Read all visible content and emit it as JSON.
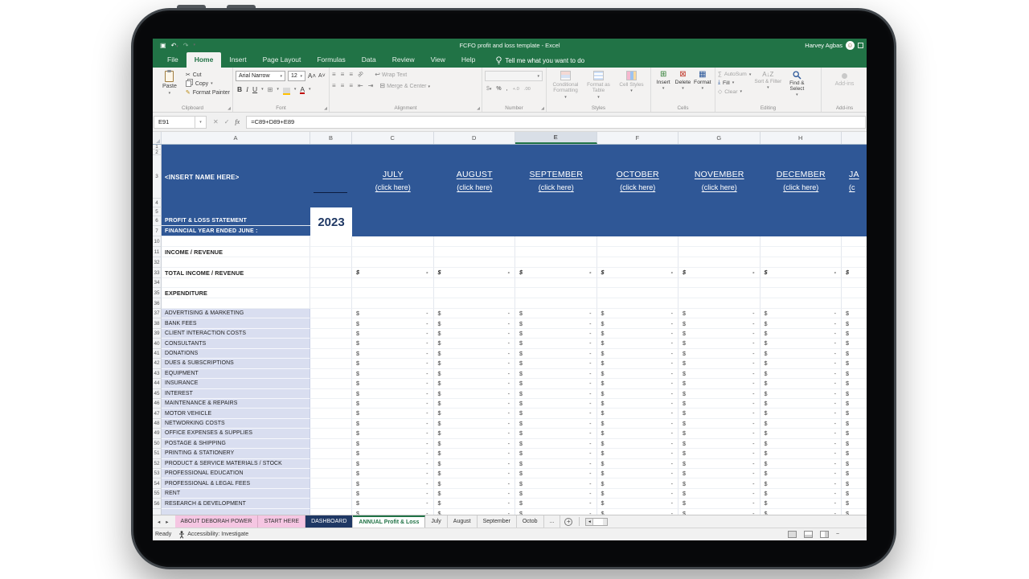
{
  "titlebar": {
    "title": "FCFO profit and loss template  -  Excel",
    "user": "Harvey Agbas"
  },
  "ribbon_tabs": [
    {
      "label": "File"
    },
    {
      "label": "Home"
    },
    {
      "label": "Insert"
    },
    {
      "label": "Page Layout"
    },
    {
      "label": "Formulas"
    },
    {
      "label": "Data"
    },
    {
      "label": "Review"
    },
    {
      "label": "View"
    },
    {
      "label": "Help"
    }
  ],
  "active_tab": "Home",
  "tell_me": "Tell me what you want to do",
  "ribbon": {
    "clipboard": {
      "label": "Clipboard",
      "paste": "Paste",
      "cut": "Cut",
      "copy": "Copy",
      "format_painter": "Format Painter"
    },
    "font": {
      "label": "Font",
      "family": "Arial Narrow",
      "size": "12"
    },
    "alignment": {
      "label": "Alignment",
      "wrap_text": "Wrap Text",
      "merge_center": "Merge & Center"
    },
    "number": {
      "label": "Number"
    },
    "styles": {
      "label": "Styles",
      "conditional": "Conditional Formatting",
      "format_as_table": "Format as Table",
      "cell_styles": "Cell Styles"
    },
    "cells": {
      "label": "Cells",
      "insert": "Insert",
      "delete": "Delete",
      "format": "Format"
    },
    "editing": {
      "label": "Editing",
      "autosum": "AutoSum",
      "fill": "Fill",
      "clear": "Clear",
      "sort_filter": "Sort & Filter",
      "find_select": "Find & Select"
    },
    "addins": {
      "label": "Add-ins",
      "button": "Add-ins"
    }
  },
  "formula_bar": {
    "cell_ref": "E91",
    "formula": "=C89+D89+E89",
    "fx": "fx"
  },
  "grid": {
    "columns": [
      "A",
      "B",
      "C",
      "D",
      "E",
      "F",
      "G",
      "H"
    ],
    "selected_column": "E",
    "row_numbers": [
      "1",
      "2",
      "3",
      "4",
      "5",
      "6",
      "7",
      "10",
      "11",
      "32",
      "33",
      "34",
      "35",
      "36",
      "37",
      "38",
      "39",
      "40",
      "41",
      "42",
      "43",
      "44",
      "45",
      "46",
      "47",
      "48",
      "49",
      "50",
      "51",
      "52",
      "53",
      "54",
      "55",
      "56"
    ],
    "insert_name": "<INSERT NAME HERE>",
    "months": [
      {
        "name": "JULY",
        "link": "(click here)"
      },
      {
        "name": "AUGUST",
        "link": "(click here)"
      },
      {
        "name": "SEPTEMBER",
        "link": "(click here)"
      },
      {
        "name": "OCTOBER",
        "link": "(click here)"
      },
      {
        "name": "NOVEMBER",
        "link": "(click here)"
      },
      {
        "name": "DECEMBER",
        "link": "(click here)"
      },
      {
        "name": "JA",
        "link": "(c"
      }
    ],
    "statement_title": "PROFIT & LOSS STATEMENT",
    "fy_label": "FINANCIAL YEAR ENDED JUNE :",
    "year": "2023",
    "income_header": "INCOME / REVENUE",
    "total_income_label": "TOTAL INCOME / REVENUE",
    "expenditure_label": "EXPENDITURE",
    "expenses": [
      "ADVERTISING & MARKETING",
      "BANK FEES",
      "CLIENT INTERACTION COSTS",
      "CONSULTANTS",
      "DONATIONS",
      "DUES & SUBSCRIPTIONS",
      "EQUIPMENT",
      "INSURANCE",
      "INTEREST",
      "MAINTENANCE & REPAIRS",
      "MOTOR VEHICLE",
      "NETWORKING COSTS",
      "OFFICE EXPENSES & SUPPLIES",
      "POSTAGE & SHIPPING",
      "PRINTING & STATIONERY",
      "PRODUCT & SERVICE MATERIALS / STOCK",
      "PROFESSIONAL EDUCATION",
      "PROFESSIONAL & LEGAL FEES",
      "RENT",
      "RESEARCH & DEVELOPMENT"
    ],
    "currency": "$",
    "zero": "-"
  },
  "sheet_bar": {
    "tabs": [
      {
        "label": "ABOUT DEBORAH POWER",
        "style": "pink"
      },
      {
        "label": "START HERE",
        "style": "pink"
      },
      {
        "label": "DASHBOARD",
        "style": "navy"
      },
      {
        "label": "ANNUAL Profit & Loss",
        "style": "active"
      },
      {
        "label": "July",
        "style": "plain"
      },
      {
        "label": "August",
        "style": "plain"
      },
      {
        "label": "September",
        "style": "plain"
      },
      {
        "label": "Octob",
        "style": "plain"
      },
      {
        "label": "...",
        "style": "plain"
      }
    ]
  },
  "status_bar": {
    "ready": "Ready",
    "accessibility": "Accessibility: Investigate"
  },
  "colors": {
    "excel_green": "#217346",
    "band_blue": "#2F5796",
    "lavender": "#D9DEF0",
    "navy_tab": "#1F3864",
    "pink_tab": "#F5C6E2",
    "year_text": "#1F3864"
  }
}
